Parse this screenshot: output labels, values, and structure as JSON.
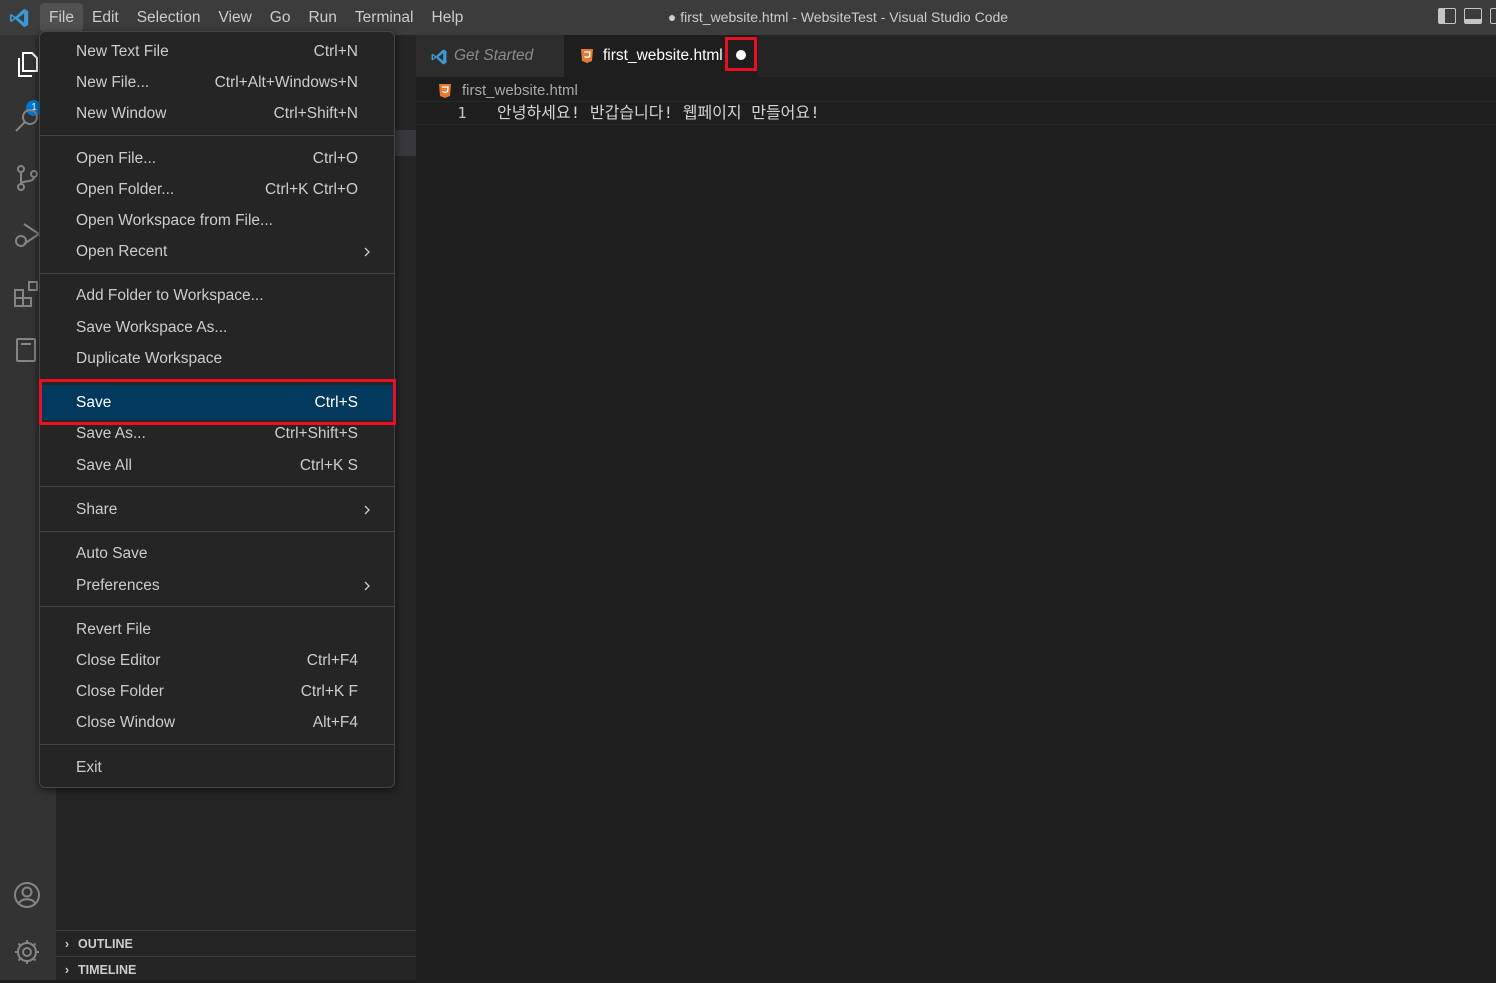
{
  "titlebar": {
    "menus": [
      "File",
      "Edit",
      "Selection",
      "View",
      "Go",
      "Run",
      "Terminal",
      "Help"
    ],
    "window_title": "● first_website.html - WebsiteTest - Visual Studio Code",
    "layout_buttons": [
      "toggle-primary-sidebar",
      "toggle-panel",
      "toggle-secondary-sidebar"
    ]
  },
  "activitybar": {
    "explorer_badge": "1",
    "icons": [
      "explorer-icon",
      "search-icon",
      "source-control-icon",
      "run-debug-icon",
      "extensions-icon",
      "remote-explorer-icon",
      "accounts-icon",
      "manage-gear-icon"
    ]
  },
  "sidebar": {
    "outline_label": "OUTLINE",
    "timeline_label": "TIMELINE"
  },
  "tabs": [
    {
      "label": "Get Started",
      "active": false,
      "icon": "vscode-icon"
    },
    {
      "label": "first_website.html",
      "active": true,
      "icon": "html5-icon",
      "dirty": true
    }
  ],
  "breadcrumb": {
    "file": "first_website.html"
  },
  "editor": {
    "line_number": "1",
    "line_text": "안녕하세요! 반갑습니다! 웹페이지 만들어요!"
  },
  "file_menu": {
    "new_text_file": {
      "label": "New Text File",
      "key": "Ctrl+N"
    },
    "new_file": {
      "label": "New File...",
      "key": "Ctrl+Alt+Windows+N"
    },
    "new_window": {
      "label": "New Window",
      "key": "Ctrl+Shift+N"
    },
    "open_file": {
      "label": "Open File...",
      "key": "Ctrl+O"
    },
    "open_folder": {
      "label": "Open Folder...",
      "key": "Ctrl+K Ctrl+O"
    },
    "open_workspace": {
      "label": "Open Workspace from File...",
      "key": ""
    },
    "open_recent": {
      "label": "Open Recent",
      "key": ""
    },
    "add_folder": {
      "label": "Add Folder to Workspace...",
      "key": ""
    },
    "save_workspace_as": {
      "label": "Save Workspace As...",
      "key": ""
    },
    "duplicate_workspace": {
      "label": "Duplicate Workspace",
      "key": ""
    },
    "save": {
      "label": "Save",
      "key": "Ctrl+S"
    },
    "save_as": {
      "label": "Save As...",
      "key": "Ctrl+Shift+S"
    },
    "save_all": {
      "label": "Save All",
      "key": "Ctrl+K S"
    },
    "share": {
      "label": "Share",
      "key": ""
    },
    "auto_save": {
      "label": "Auto Save",
      "key": ""
    },
    "preferences": {
      "label": "Preferences",
      "key": ""
    },
    "revert_file": {
      "label": "Revert File",
      "key": ""
    },
    "close_editor": {
      "label": "Close Editor",
      "key": "Ctrl+F4"
    },
    "close_folder": {
      "label": "Close Folder",
      "key": "Ctrl+K F"
    },
    "close_window": {
      "label": "Close Window",
      "key": "Alt+F4"
    },
    "exit": {
      "label": "Exit",
      "key": ""
    }
  },
  "colors": {
    "highlight_border": "#e81123",
    "menu_selection": "#04395e",
    "html_icon": "#e37933",
    "vscode_blue": "#3c99d4"
  }
}
